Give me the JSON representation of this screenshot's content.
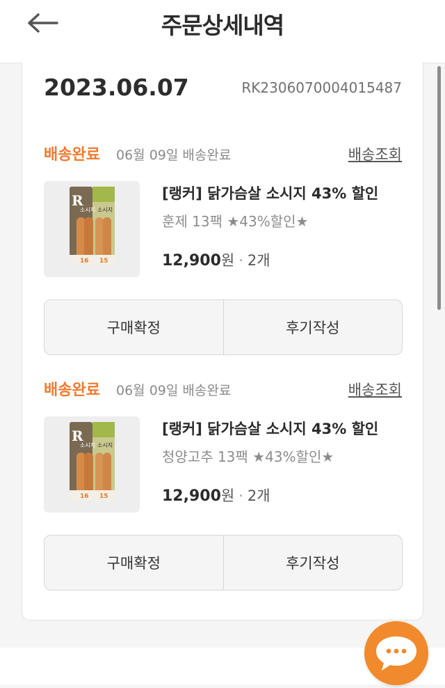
{
  "header": {
    "title": "주문상세내역"
  },
  "order": {
    "date": "2023.06.07",
    "number": "RK2306070004015487"
  },
  "items": [
    {
      "status": "배송완료",
      "delivery_info": "06월 09일 배송완료",
      "tracking_label": "배송조회",
      "name": "[랭커] 닭가슴살 소시지 43% 할인",
      "option": "훈제 13팩 ★43%할인★",
      "price": "12,900",
      "currency": "원",
      "quantity": "2개",
      "buttons": [
        "구매확정",
        "후기작성"
      ]
    },
    {
      "status": "배송완료",
      "delivery_info": "06월 09일 배송완료",
      "tracking_label": "배송조회",
      "name": "[랭커] 닭가슴살 소시지 43% 할인",
      "option": "청양고추 13팩 ★43%할인★",
      "price": "12,900",
      "currency": "원",
      "quantity": "2개",
      "buttons": [
        "구매확정",
        "후기작성"
      ]
    }
  ],
  "product_image_text": {
    "badge": "R",
    "pack_left": "소시지",
    "pack_right": "소시지",
    "count_left": "16",
    "count_right": "15"
  },
  "colors": {
    "accent": "#f07a2e",
    "chat": "#f08a2c"
  }
}
